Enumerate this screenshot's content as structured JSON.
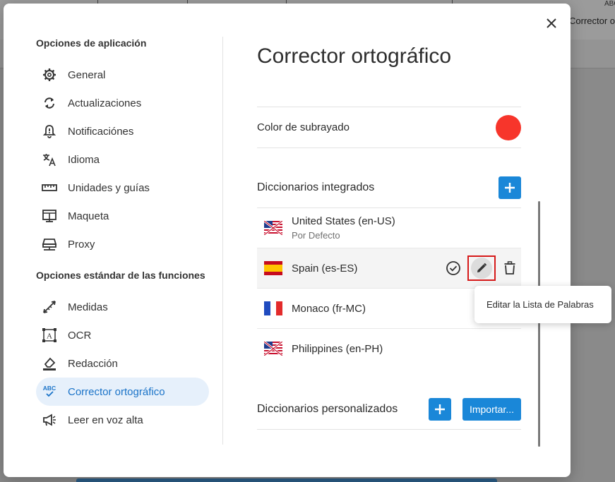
{
  "background": {
    "right_toolbar_label": "Corrector o",
    "right_toolbar_icon": "ABC"
  },
  "sidebar": {
    "app_section_title": "Opciones de aplicación",
    "app_items": [
      {
        "label": "General",
        "icon": "gear-icon"
      },
      {
        "label": "Actualizaciones",
        "icon": "refresh-icon"
      },
      {
        "label": "Notificaciónes",
        "icon": "bell-alert-icon"
      },
      {
        "label": "Idioma",
        "icon": "translate-icon"
      },
      {
        "label": "Unidades y guías",
        "icon": "ruler-icon"
      },
      {
        "label": "Maqueta",
        "icon": "layout-icon"
      },
      {
        "label": "Proxy",
        "icon": "network-icon"
      }
    ],
    "features_section_title": "Opciones estándar de las funciones",
    "feature_items": [
      {
        "label": "Medidas",
        "icon": "measure-icon"
      },
      {
        "label": "OCR",
        "icon": "ocr-icon"
      },
      {
        "label": "Redacción",
        "icon": "eraser-icon"
      },
      {
        "label": "Corrector ortográfico",
        "icon": "spellcheck-icon",
        "active": true
      },
      {
        "label": "Leer en voz alta",
        "icon": "megaphone-icon"
      }
    ]
  },
  "main": {
    "title": "Corrector ortográfico",
    "underline_color_label": "Color de subrayado",
    "underline_color": "#f7352b",
    "builtin_dicts_title": "Diccionarios integrados",
    "dictionaries": [
      {
        "name": "United States (en-US)",
        "sub": "Por Defecto",
        "flag": "us-flag-icon"
      },
      {
        "name": "Spain (es-ES)",
        "sub": "",
        "flag": "spain-flag-icon"
      },
      {
        "name": "Monaco (fr-MC)",
        "sub": "",
        "flag": "france-flag-icon"
      },
      {
        "name": "Philippines (en-PH)",
        "sub": "",
        "flag": "us-flag-icon"
      }
    ],
    "custom_dicts_title": "Diccionarios personalizados",
    "import_label": "Importar..."
  },
  "tooltip": {
    "text": "Editar la Lista de Palabras"
  },
  "colors": {
    "accent": "#1a87d8",
    "active_bg": "#e6f0fb",
    "active_text": "#1a73c8",
    "highlight_border": "#d61a1a"
  }
}
